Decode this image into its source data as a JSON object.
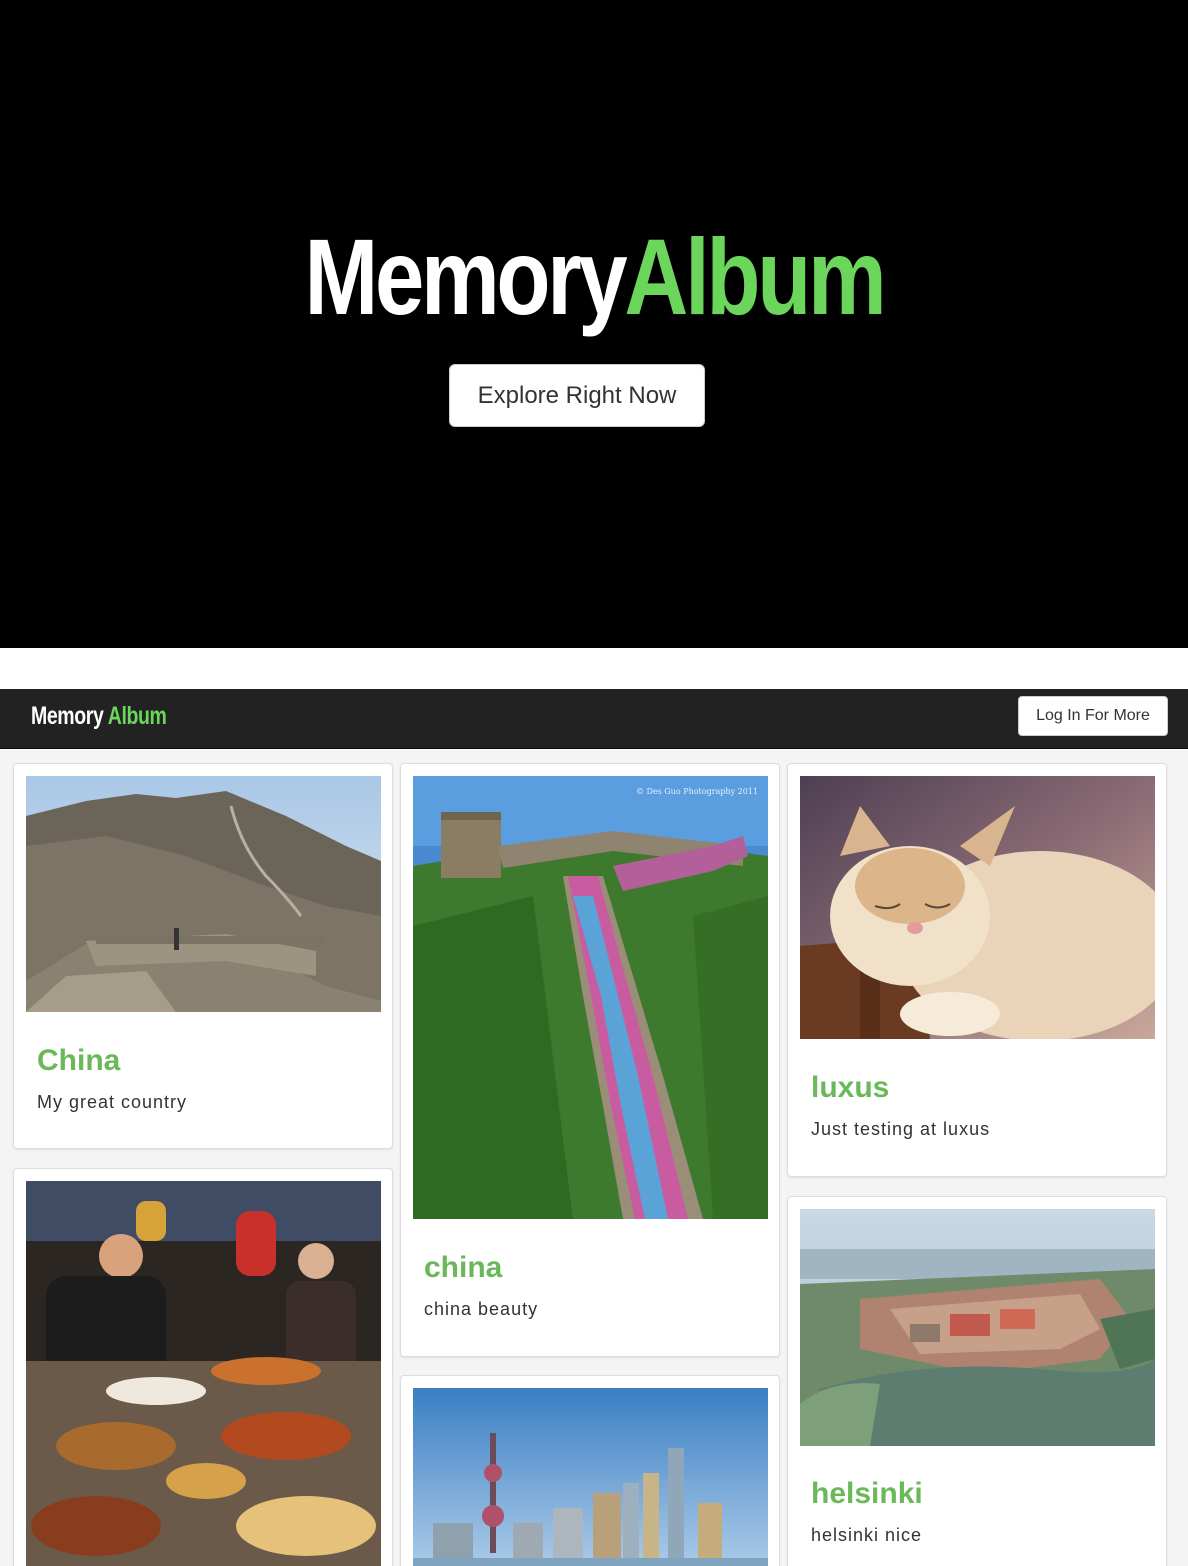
{
  "hero": {
    "title_part1": "Memory",
    "title_part2": "Album",
    "cta_label": "Explore Right Now"
  },
  "navbar": {
    "brand_part1": "Memory",
    "brand_part2": "Album",
    "login_label": "Log In For More"
  },
  "colors": {
    "accent": "#6cd65c",
    "card_title": "#6bb85a",
    "navbar_bg": "#222222",
    "hero_bg": "#000000"
  },
  "albums": [
    {
      "title": "China",
      "description": "My great country",
      "image": "great-wall-mountain-photo"
    },
    {
      "title": "china",
      "description": "china beauty",
      "image": "great-wall-crowd-photo",
      "watermark": "© Des Guo Photography 2011"
    },
    {
      "title": "luxus",
      "description": "Just testing at luxus",
      "image": "sleeping-cat-photo"
    },
    {
      "title": "",
      "description": "",
      "image": "food-market-photo"
    },
    {
      "title": "",
      "description": "",
      "image": "shanghai-skyline-photo"
    },
    {
      "title": "helsinki",
      "description": "helsinki nice",
      "image": "helsinki-aerial-photo"
    }
  ]
}
